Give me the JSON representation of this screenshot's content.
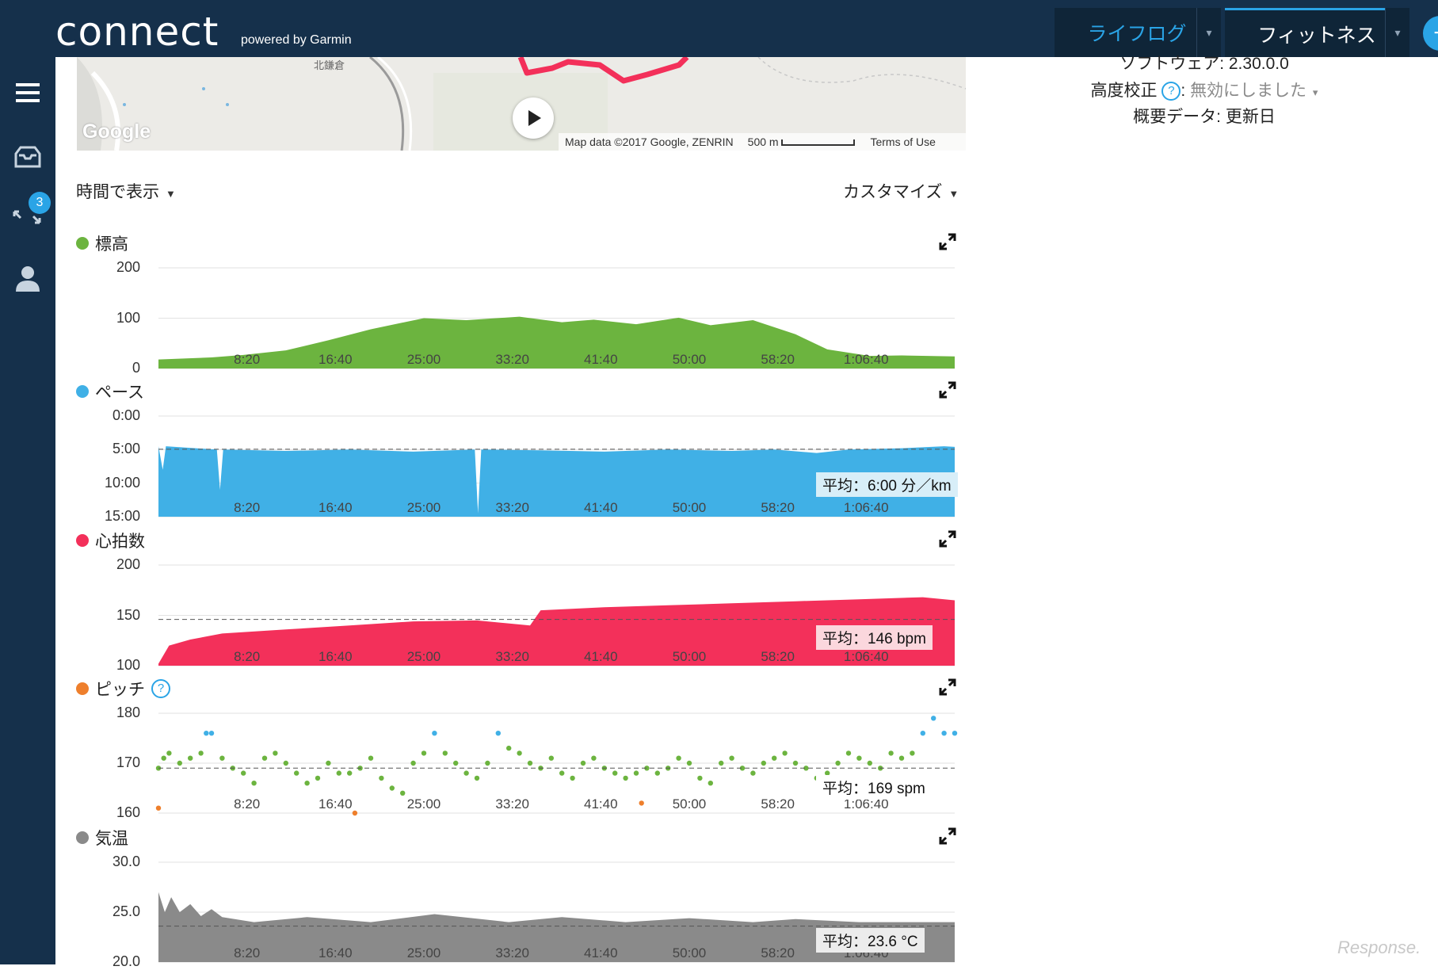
{
  "app": {
    "logo": "connect",
    "logo_sub": "powered by Garmin"
  },
  "nav": {
    "tabs": [
      {
        "label": "ライフログ",
        "active": false
      },
      {
        "label": "フィットネス",
        "active": true
      }
    ],
    "caret": "▾"
  },
  "sidebar": {
    "items": [
      "menu-icon",
      "inbox-icon",
      "connections-icon",
      "profile-icon"
    ],
    "badge": "3"
  },
  "map": {
    "place_label": "北鎌倉",
    "google_logo": "Google",
    "attribution": "Map data ©2017 Google, ZENRIN",
    "scale": "500 m",
    "terms": "Terms of Use"
  },
  "device_info": {
    "software": "ソフトウェア: 2.30.0.0",
    "calibration_label": "高度校正",
    "calibration_value": "無効にしました",
    "summary": "概要データ: 更新日"
  },
  "controls": {
    "view_by": "時間で表示",
    "customize": "カスタマイズ"
  },
  "colors": {
    "elevation": "#6cb43f",
    "pace": "#40b0e6",
    "heart_rate": "#f3305a",
    "cadence": "#ee7f2c",
    "cadence_mid": "#6cb43f",
    "cadence_high": "#40b0e6",
    "temperature": "#8a8a8a",
    "accent": "#2aa4e6"
  },
  "x_ticks": [
    "8:20",
    "16:40",
    "25:00",
    "33:20",
    "41:40",
    "50:00",
    "58:20",
    "1:06:40"
  ],
  "charts": [
    {
      "id": "elevation",
      "title": "標高",
      "type": "area",
      "y_ticks": [
        "200",
        "100",
        "0"
      ],
      "ylim": [
        0,
        200
      ],
      "avg_label": "",
      "x_minutes": [
        0,
        5,
        8,
        12,
        16,
        20,
        25,
        29,
        34,
        38,
        41,
        45,
        49,
        52,
        56,
        60,
        63,
        67,
        70,
        75
      ],
      "values": [
        18,
        22,
        27,
        36,
        56,
        78,
        100,
        96,
        103,
        92,
        97,
        88,
        101,
        86,
        96,
        68,
        38,
        25,
        26,
        24
      ]
    },
    {
      "id": "pace",
      "title": "ペース",
      "type": "area",
      "y_ticks": [
        "0:00",
        "5:00",
        "10:00",
        "15:00"
      ],
      "ylim": [
        0,
        15
      ],
      "avg_label": "平均：6:00 分／km",
      "x_minutes": [
        0,
        0.4,
        0.7,
        5.5,
        5.8,
        6.1,
        12,
        18,
        24,
        29.8,
        30.1,
        30.4,
        36,
        42,
        48,
        54,
        58,
        62,
        65,
        70,
        74,
        75
      ],
      "values": [
        4.5,
        8.0,
        4.5,
        5.0,
        11.0,
        5.0,
        5.2,
        5.0,
        5.3,
        5.0,
        14.5,
        5.0,
        5.1,
        5.3,
        5.0,
        5.2,
        5.0,
        5.5,
        5.0,
        4.8,
        4.5,
        4.6
      ]
    },
    {
      "id": "heart_rate",
      "title": "心拍数",
      "type": "area",
      "y_ticks": [
        "200",
        "150",
        "100"
      ],
      "ylim": [
        100,
        200
      ],
      "avg_label": "平均：146 bpm",
      "x_minutes": [
        0,
        1,
        3,
        6,
        12,
        18,
        24,
        30,
        35,
        36,
        42,
        48,
        54,
        60,
        66,
        72,
        75
      ],
      "values": [
        102,
        120,
        126,
        132,
        136,
        140,
        144,
        145,
        140,
        155,
        158,
        160,
        162,
        164,
        166,
        168,
        165
      ]
    },
    {
      "id": "cadence",
      "title": "ピッチ",
      "type": "scatter",
      "y_ticks": [
        "180",
        "170",
        "160"
      ],
      "ylim": [
        160,
        180
      ],
      "avg_label": "平均：169 spm",
      "points_note": "",
      "points": [
        [
          0,
          169
        ],
        [
          0.5,
          171
        ],
        [
          1,
          172
        ],
        [
          2,
          170
        ],
        [
          3,
          171
        ],
        [
          4,
          172
        ],
        [
          4.5,
          176
        ],
        [
          5,
          176
        ],
        [
          6,
          171
        ],
        [
          7,
          169
        ],
        [
          8,
          168
        ],
        [
          9,
          166
        ],
        [
          10,
          171
        ],
        [
          11,
          172
        ],
        [
          12,
          170
        ],
        [
          13,
          168
        ],
        [
          14,
          166
        ],
        [
          15,
          167
        ],
        [
          16,
          170
        ],
        [
          17,
          168
        ],
        [
          18,
          168
        ],
        [
          19,
          169
        ],
        [
          20,
          171
        ],
        [
          21,
          167
        ],
        [
          22,
          165
        ],
        [
          23,
          164
        ],
        [
          24,
          170
        ],
        [
          25,
          172
        ],
        [
          26,
          176
        ],
        [
          27,
          172
        ],
        [
          28,
          170
        ],
        [
          29,
          168
        ],
        [
          30,
          167
        ],
        [
          31,
          170
        ],
        [
          32,
          176
        ],
        [
          33,
          173
        ],
        [
          34,
          172
        ],
        [
          35,
          170
        ],
        [
          36,
          169
        ],
        [
          37,
          171
        ],
        [
          38,
          168
        ],
        [
          39,
          167
        ],
        [
          40,
          170
        ],
        [
          41,
          171
        ],
        [
          42,
          169
        ],
        [
          43,
          168
        ],
        [
          44,
          167
        ],
        [
          45,
          168
        ],
        [
          46,
          169
        ],
        [
          47,
          168
        ],
        [
          48,
          169
        ],
        [
          49,
          171
        ],
        [
          50,
          170
        ],
        [
          51,
          167
        ],
        [
          52,
          166
        ],
        [
          53,
          170
        ],
        [
          54,
          171
        ],
        [
          55,
          169
        ],
        [
          56,
          168
        ],
        [
          57,
          170
        ],
        [
          58,
          171
        ],
        [
          59,
          172
        ],
        [
          60,
          170
        ],
        [
          61,
          169
        ],
        [
          62,
          167
        ],
        [
          63,
          168
        ],
        [
          64,
          170
        ],
        [
          65,
          172
        ],
        [
          66,
          171
        ],
        [
          67,
          170
        ],
        [
          68,
          169
        ],
        [
          69,
          172
        ],
        [
          70,
          171
        ],
        [
          71,
          172
        ],
        [
          72,
          176
        ],
        [
          73,
          179
        ],
        [
          74,
          176
        ],
        [
          75,
          176
        ],
        [
          0,
          161
        ],
        [
          18.5,
          160
        ],
        [
          45.5,
          162
        ]
      ]
    },
    {
      "id": "temperature",
      "title": "気温",
      "type": "area",
      "y_ticks": [
        "30.0",
        "25.0",
        "20.0"
      ],
      "ylim": [
        20,
        30
      ],
      "avg_label": "平均：23.6 °C",
      "x_minutes": [
        0,
        0.6,
        1.2,
        2,
        3,
        4,
        5,
        6,
        9,
        14,
        20,
        26,
        33,
        38,
        44,
        50,
        56,
        60,
        66,
        72,
        75
      ],
      "values": [
        27.0,
        25.0,
        26.5,
        25.0,
        25.8,
        24.6,
        25.3,
        24.5,
        24.0,
        24.5,
        24.0,
        24.8,
        24.0,
        24.5,
        24.0,
        24.4,
        24.0,
        24.3,
        24.0,
        24.0,
        24.0
      ]
    }
  ],
  "watermark": "Response."
}
